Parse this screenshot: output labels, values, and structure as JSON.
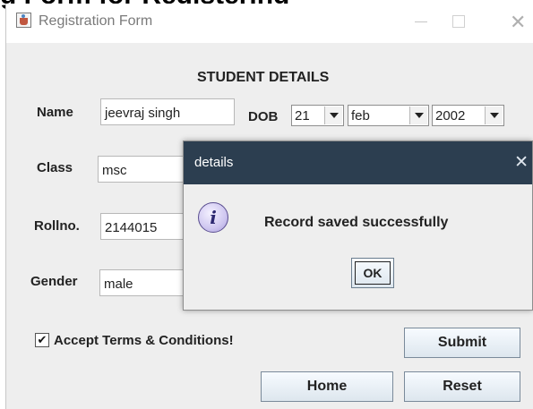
{
  "window": {
    "title": "Registration Form"
  },
  "form": {
    "heading": "STUDENT DETAILS",
    "name_label": "Name",
    "name_value": "jeevraj singh",
    "dob_label": "DOB",
    "dob_day": "21",
    "dob_month": "feb",
    "dob_year": "2002",
    "class_label": "Class",
    "class_value": "msc",
    "rollno_label": "Rollno.",
    "rollno_value": "2144015",
    "gender_label": "Gender",
    "gender_value": "male",
    "terms_label": "Accept Terms & Conditions!",
    "terms_checked": true,
    "submit_label": "Submit",
    "home_label": "Home",
    "reset_label": "Reset"
  },
  "dialog": {
    "title": "details",
    "message": "Record saved successfully",
    "ok_label": "OK",
    "icon": "info-icon"
  },
  "colors": {
    "dialog_titlebar": "#2c3e50",
    "window_bg": "#eeeeee"
  }
}
